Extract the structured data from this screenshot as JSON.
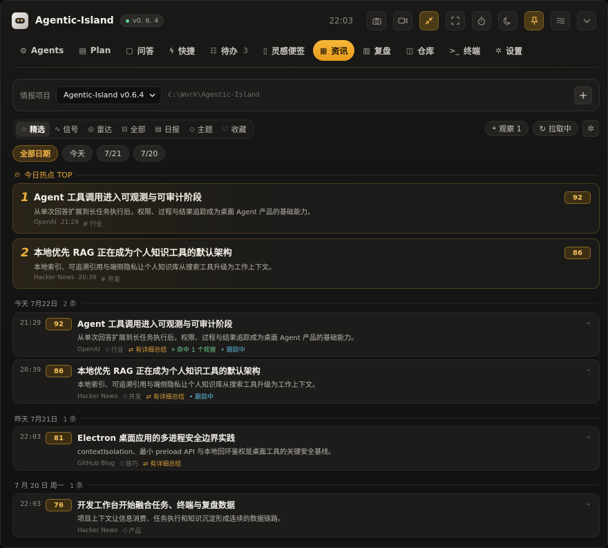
{
  "app": {
    "title": "Agentic-Island",
    "version": "v0. 6. 4",
    "clock": "22:03"
  },
  "toolbar": {
    "icons": [
      "camera-icon",
      "video-icon",
      "collapse-icon",
      "expand-icon",
      "timer-icon",
      "moon-icon",
      "pin-icon",
      "waves-icon",
      "chevron-down-icon"
    ]
  },
  "nav": [
    {
      "label": "Agents",
      "icon": "robot-icon"
    },
    {
      "label": "Plan",
      "icon": "clipboard-icon"
    },
    {
      "label": "问答",
      "icon": "chat-icon"
    },
    {
      "label": "快捷",
      "icon": "bolt-icon"
    },
    {
      "label": "待办",
      "icon": "checklist-icon",
      "badge": "3"
    },
    {
      "label": "灵感便签",
      "icon": "note-icon"
    },
    {
      "label": "资讯",
      "icon": "news-icon",
      "active": true
    },
    {
      "label": "复盘",
      "icon": "chart-icon"
    },
    {
      "label": "仓库",
      "icon": "repo-icon"
    },
    {
      "label": "终端",
      "icon": "terminal-icon"
    },
    {
      "label": "设置",
      "icon": "gear-icon"
    }
  ],
  "project": {
    "label": "情报项目",
    "selected": "Agentic-Island v0.6.4",
    "path": "C:\\Work\\Agentic-Island",
    "add_label": "+"
  },
  "filters": [
    {
      "label": "精选",
      "icon": "star-icon",
      "active": true
    },
    {
      "label": "信号",
      "icon": "pulse-icon"
    },
    {
      "label": "雷达",
      "icon": "radar-icon"
    },
    {
      "label": "全部",
      "icon": "inbox-icon"
    },
    {
      "label": "日报",
      "icon": "report-icon"
    },
    {
      "label": "主题",
      "icon": "tag-icon"
    },
    {
      "label": "收藏",
      "icon": "heart-icon"
    }
  ],
  "controls": {
    "observe": "观察 1",
    "fetching": "拉取中"
  },
  "dates": [
    {
      "label": "全部日期",
      "active": true
    },
    {
      "label": "今天"
    },
    {
      "label": "7/21"
    },
    {
      "label": "7/20"
    }
  ],
  "hot": {
    "heading": "今日热点 TOP",
    "items": [
      {
        "rank": "1",
        "title": "Agent 工具调用进入可观测与可审计阶段",
        "desc": "从单次回答扩展到长任务执行后，权限、过程与结果追踪成为桌面 Agent 产品的基础能力。",
        "source": "OpenAI",
        "time": "21:29",
        "tag": "# 行业",
        "score": "92"
      },
      {
        "rank": "2",
        "title": "本地优先 RAG 正在成为个人知识工具的默认架构",
        "desc": "本地索引、可追溯引用与端侧隐私让个人知识库从搜索工具升级为工作上下文。",
        "source": "Hacker News",
        "time": "20:39",
        "tag": "# 开发",
        "score": "86"
      }
    ]
  },
  "groups": [
    {
      "date": "今天 7月22日",
      "count": "2 条",
      "items": [
        {
          "time": "21:29",
          "score": "92",
          "title": "Agent 工具调用进入可观测与可审计阶段",
          "desc": "从单次回答扩展到长任务执行后，权限、过程与结果追踪成为桌面 Agent 产品的基础能力。",
          "source": "OpenAI",
          "tag": "行业",
          "summary": "有详细总结",
          "observe": "命中 1 个观察",
          "status": "跟踪中"
        },
        {
          "time": "20:39",
          "score": "86",
          "title": "本地优先 RAG 正在成为个人知识工具的默认架构",
          "desc": "本地索引、可追溯引用与端侧隐私让个人知识库从搜索工具升级为工作上下文。",
          "source": "Hacker News",
          "tag": "开发",
          "summary": "有详细总结",
          "status": "跟踪中"
        }
      ]
    },
    {
      "date": "昨天 7月21日",
      "count": "1 条",
      "items": [
        {
          "time": "22:03",
          "score": "81",
          "title": "Electron 桌面应用的多进程安全边界实践",
          "desc": "contextIsolation、最小 preload API 与本地回环鉴权是桌面工具的关键安全基线。",
          "source": "GitHub Blog",
          "tag": "技巧",
          "summary": "有详细总结"
        }
      ]
    },
    {
      "date": "7 月 20 日 周一",
      "count": "1 条",
      "items": [
        {
          "time": "22:03",
          "score": "76",
          "title": "开发工作台开始融合任务、终端与复盘数据",
          "desc": "项目上下文让信息消费、任务执行和知识沉淀形成连续的数据链路。",
          "source": "Hacker News",
          "tag": "产品"
        }
      ]
    }
  ],
  "colors": {
    "accent": "#f0b440",
    "background": "#121213",
    "card": "#1d1c1b"
  }
}
